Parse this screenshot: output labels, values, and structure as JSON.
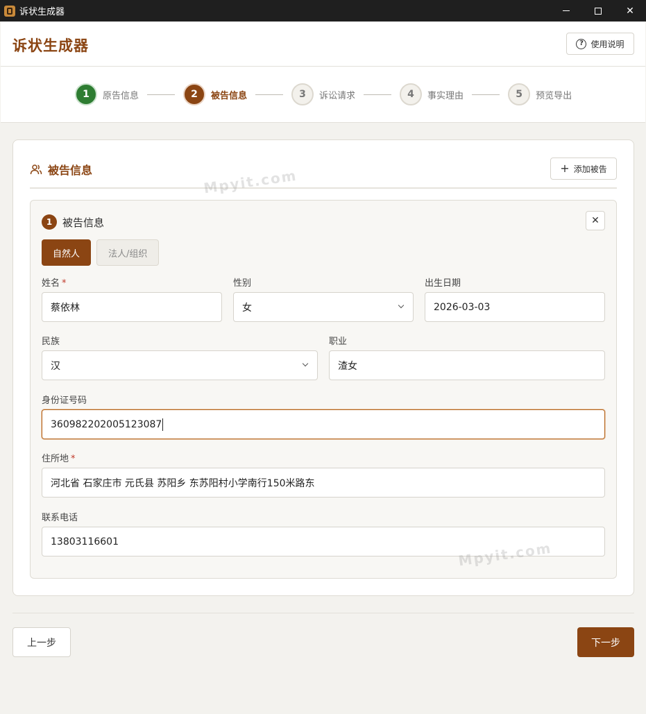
{
  "window": {
    "title": "诉状生成器"
  },
  "header": {
    "title": "诉状生成器",
    "help_label": "使用说明"
  },
  "steps": [
    {
      "num": "1",
      "label": "原告信息",
      "state": "done"
    },
    {
      "num": "2",
      "label": "被告信息",
      "state": "active"
    },
    {
      "num": "3",
      "label": "诉讼请求",
      "state": "todo"
    },
    {
      "num": "4",
      "label": "事实理由",
      "state": "todo"
    },
    {
      "num": "5",
      "label": "预览导出",
      "state": "todo"
    }
  ],
  "section": {
    "title": "被告信息",
    "add_label": "添加被告"
  },
  "defendant": {
    "index": "1",
    "title": "被告信息",
    "close_glyph": "✕",
    "type_tabs": {
      "natural": "自然人",
      "legal": "法人/组织"
    },
    "fields": {
      "name": {
        "label": "姓名",
        "required_mark": "*",
        "value": "蔡依林"
      },
      "gender": {
        "label": "性别",
        "value": "女"
      },
      "birth": {
        "label": "出生日期",
        "value": "2026-03-03"
      },
      "ethnicity": {
        "label": "民族",
        "value": "汉"
      },
      "occupation": {
        "label": "职业",
        "value": "渣女"
      },
      "id_number": {
        "label": "身份证号码",
        "value": "360982202005123087"
      },
      "address": {
        "label": "住所地",
        "required_mark": "*",
        "value": "河北省 石家庄市 元氏县 苏阳乡 东苏阳村小学南行150米路东"
      },
      "phone": {
        "label": "联系电话",
        "value": "13803116601"
      }
    }
  },
  "footer": {
    "prev_label": "上一步",
    "next_label": "下一步"
  },
  "watermark": "Mpyit.com",
  "colors": {
    "brand": "#8b4513",
    "done": "#2e7d32",
    "required": "#c0392b"
  }
}
